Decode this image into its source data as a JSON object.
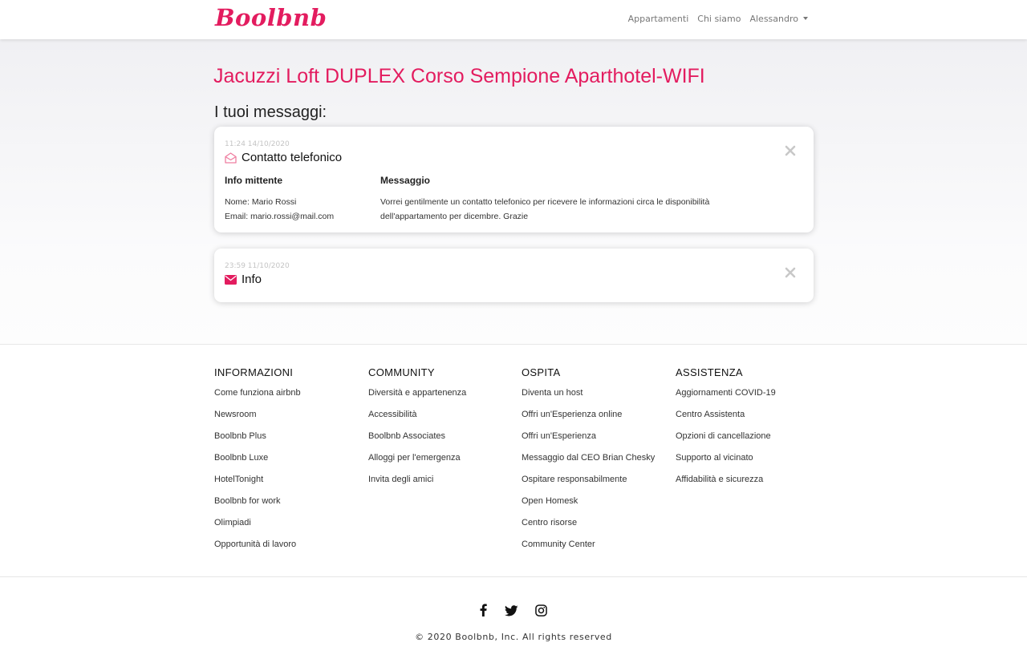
{
  "brand": {
    "name": "Boolbnb",
    "color": "#e31c5f"
  },
  "nav": {
    "links": [
      "Appartamenti",
      "Chi siamo"
    ],
    "user": "Alessandro"
  },
  "page": {
    "title": "Jacuzzi Loft DUPLEX Corso Sempione Aparthotel-WIFI",
    "section_title": "I tuoi messaggi:"
  },
  "messages": [
    {
      "time": "11:24 14/10/2020",
      "subject": "Contatto telefonico",
      "icon": "envelope-open-icon",
      "read": true,
      "sender_heading": "Info mittente",
      "sender_name": "Nome: Mario Rossi",
      "sender_email": "Email: mario.rossi@mail.com",
      "message_heading": "Messaggio",
      "message_text": "Vorrei gentilmente un contatto telefonico per ricevere le informazioni circa le disponibilità dell'appartamento per dicembre. Grazie"
    },
    {
      "time": "23:59 11/10/2020",
      "subject": "Info",
      "icon": "envelope-icon",
      "read": false
    }
  ],
  "footer": {
    "columns": [
      {
        "title": "INFORMAZIONI",
        "links": [
          "Come funziona airbnb",
          "Newsroom",
          "Boolbnb Plus",
          "Boolbnb Luxe",
          "HotelTonight",
          "Boolbnb for work",
          "Olimpiadi",
          "Opportunità di lavoro"
        ]
      },
      {
        "title": "COMMUNITY",
        "links": [
          "Diversità e appartenenza",
          "Accessibilità",
          "Boolbnb Associates",
          "Alloggi per l'emergenza",
          "Invita degli amici"
        ]
      },
      {
        "title": "OSPITA",
        "links": [
          "Diventa un host",
          "Offri un'Esperienza online",
          "Offri un'Esperienza",
          "Messaggio dal CEO Brian Chesky",
          "Ospitare responsabilmente",
          "Open Homesk",
          "Centro risorse",
          "Community Center"
        ]
      },
      {
        "title": "ASSISTENZA",
        "links": [
          "Aggiornamenti COVID-19",
          "Centro Assistenta",
          "Opzioni di cancellazione",
          "Supporto al vicinato",
          "Affidabilità e sicurezza"
        ]
      }
    ],
    "socials": [
      "facebook-icon",
      "twitter-icon",
      "instagram-icon"
    ],
    "copyright": "© 2020 Boolbnb, Inc. All rights reserved"
  }
}
